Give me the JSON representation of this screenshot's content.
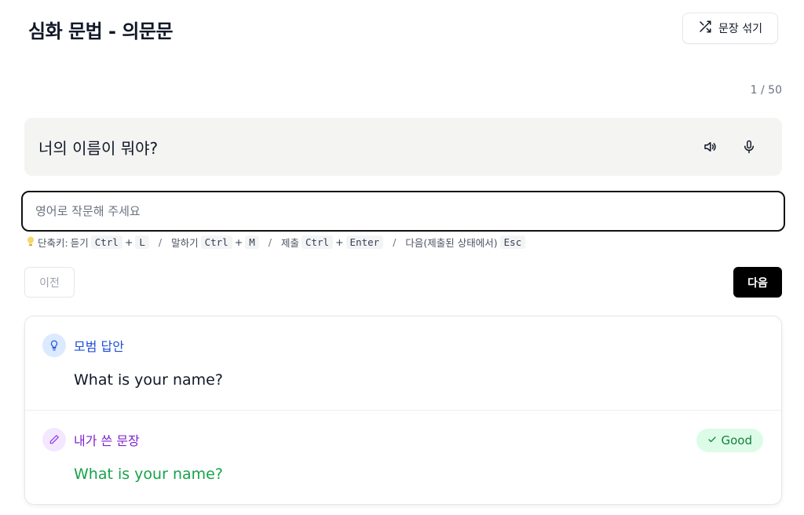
{
  "header": {
    "title": "심화 문법 - 의문문",
    "shuffle_label": "문장 섞기"
  },
  "progress": {
    "counter": "1 / 50"
  },
  "prompt": {
    "sentence": "너의 이름이 뭐야?"
  },
  "answer_input": {
    "value": "",
    "placeholder": "영어로 작문해 주세요"
  },
  "shortcuts": {
    "prefix": "단축키:",
    "listen": {
      "label": "듣기",
      "mod": "Ctrl",
      "key": "L"
    },
    "speak": {
      "label": "말하기",
      "mod": "Ctrl",
      "key": "M"
    },
    "submit": {
      "label": "제출",
      "mod": "Ctrl",
      "key": "Enter"
    },
    "next": {
      "label": "다음(제출된 상태에서)",
      "key": "Esc"
    },
    "separator": "/",
    "plus": "+"
  },
  "nav": {
    "prev_label": "이전",
    "next_label": "다음"
  },
  "result": {
    "model_answer": {
      "title": "모범 답안",
      "text": "What is your name?"
    },
    "my_answer": {
      "title": "내가 쓴 문장",
      "text": "What is your name?",
      "badge": "Good"
    }
  },
  "colors": {
    "accent_blue": "#1d4ed8",
    "accent_purple": "#7e22ce",
    "success_green": "#16a34a",
    "badge_bg": "#dcfce7"
  }
}
